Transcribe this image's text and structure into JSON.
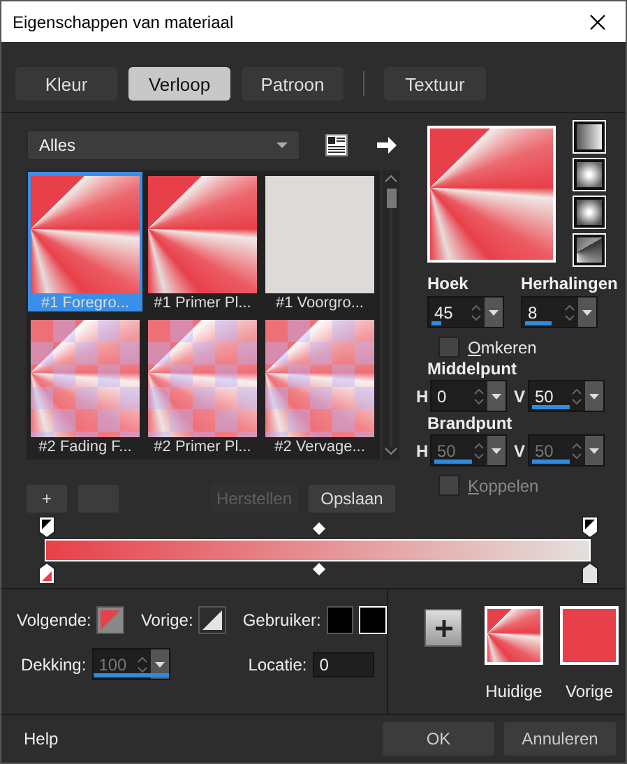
{
  "window": {
    "title": "Eigenschappen van materiaal"
  },
  "tabs": [
    {
      "label": "Kleur",
      "selected": false
    },
    {
      "label": "Verloop",
      "selected": true
    },
    {
      "label": "Patroon",
      "selected": false
    },
    {
      "label": "Textuur",
      "selected": false
    }
  ],
  "category": {
    "value": "Alles"
  },
  "gradients": [
    {
      "label": "#1 Foregro...",
      "kind": "sunburst",
      "selected": true
    },
    {
      "label": "#1 Primer Pl...",
      "kind": "sunburst",
      "selected": false
    },
    {
      "label": "#1 Voorgro...",
      "kind": "flat",
      "selected": false
    },
    {
      "label": "#2 Fading F...",
      "kind": "checkered",
      "selected": false
    },
    {
      "label": "#2 Primer Pl...",
      "kind": "checkered",
      "selected": false
    },
    {
      "label": "#2 Vervage...",
      "kind": "checkered",
      "selected": false
    }
  ],
  "angle": {
    "label": "Hoek",
    "value": "45",
    "level": 0.125
  },
  "repeats": {
    "label": "Herhalingen",
    "value": "8",
    "level": 0.35
  },
  "invert": {
    "label": "Omkeren",
    "checked": false,
    "disabled": false
  },
  "center": {
    "label": "Middelpunt",
    "disabled": false,
    "h": {
      "label": "H",
      "value": "0",
      "level": 0
    },
    "v": {
      "label": "V",
      "value": "50",
      "level": 0.5
    }
  },
  "focal": {
    "label": "Brandpunt",
    "disabled": true,
    "h": {
      "label": "H",
      "value": "50",
      "level": 0.5
    },
    "v": {
      "label": "V",
      "value": "50",
      "level": 0.5
    }
  },
  "link": {
    "label": "Koppelen",
    "checked": false,
    "disabled": true
  },
  "buttons": [
    {
      "kind": "add",
      "label": "+"
    },
    {
      "kind": "remove"
    },
    {
      "kind": "text",
      "label": "Herstellen",
      "disabled": true
    },
    {
      "kind": "text",
      "label": "Opslaan",
      "disabled": false
    }
  ],
  "stops": {
    "next": "Volgende:",
    "previous": "Vorige:",
    "user": "Gebruiker:"
  },
  "opacity": {
    "label": "Dekking:",
    "value": "100",
    "level": 1,
    "disabled": true
  },
  "location": {
    "label": "Locatie:",
    "value": "0"
  },
  "swatches": [
    {
      "label": "Huidige",
      "kind": "gradient"
    },
    {
      "label": "Vorige",
      "kind": "solid"
    }
  ],
  "footer": {
    "help": "Help",
    "ok": "OK",
    "cancel": "Annuleren"
  }
}
